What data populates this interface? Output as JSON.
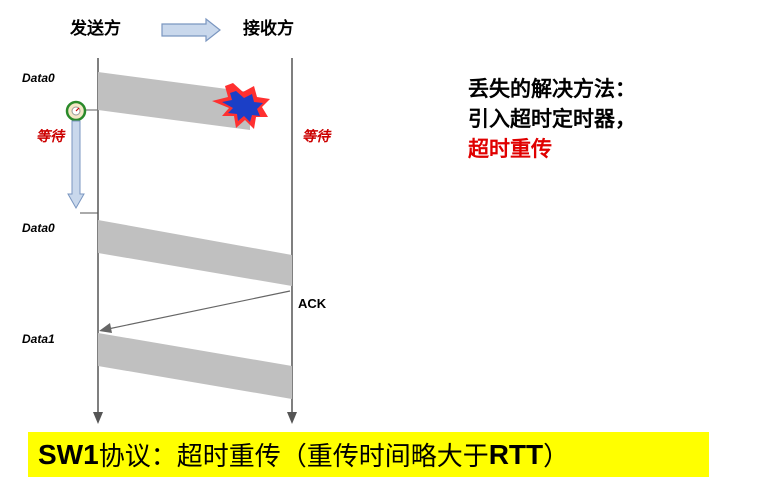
{
  "header": {
    "sender": "发送方",
    "receiver": "接收方"
  },
  "frames": [
    {
      "label": "Data0",
      "status": "lost"
    },
    {
      "label": "Data0"
    },
    {
      "label": "Data1"
    }
  ],
  "wait_labels": {
    "sender": "等待",
    "receiver": "等待"
  },
  "ack_label": "ACK",
  "solution": {
    "line1": "丢失的解决方法：",
    "line2": "引入超时定时器，",
    "line3": "超时重传"
  },
  "banner": {
    "bold_prefix": "SW1",
    "mid": "协议：超时重传（重传时间略大于",
    "bold_tail": "RTT",
    "end": "）"
  },
  "colors": {
    "frame_fill": "#c0c0c0",
    "timeline": "#555555",
    "burst_outer": "#ff3030",
    "burst_inner": "#1b3fc7",
    "wait_text": "#cc0000",
    "highlight_text": "#e00000",
    "banner_bg": "#ffff00",
    "arrow_fill": "#c9d8ec",
    "arrow_stroke": "#7a96c0"
  },
  "icons": {
    "timer": "stopwatch-icon",
    "direction": "right-arrow-icon",
    "loss": "burst-icon"
  }
}
